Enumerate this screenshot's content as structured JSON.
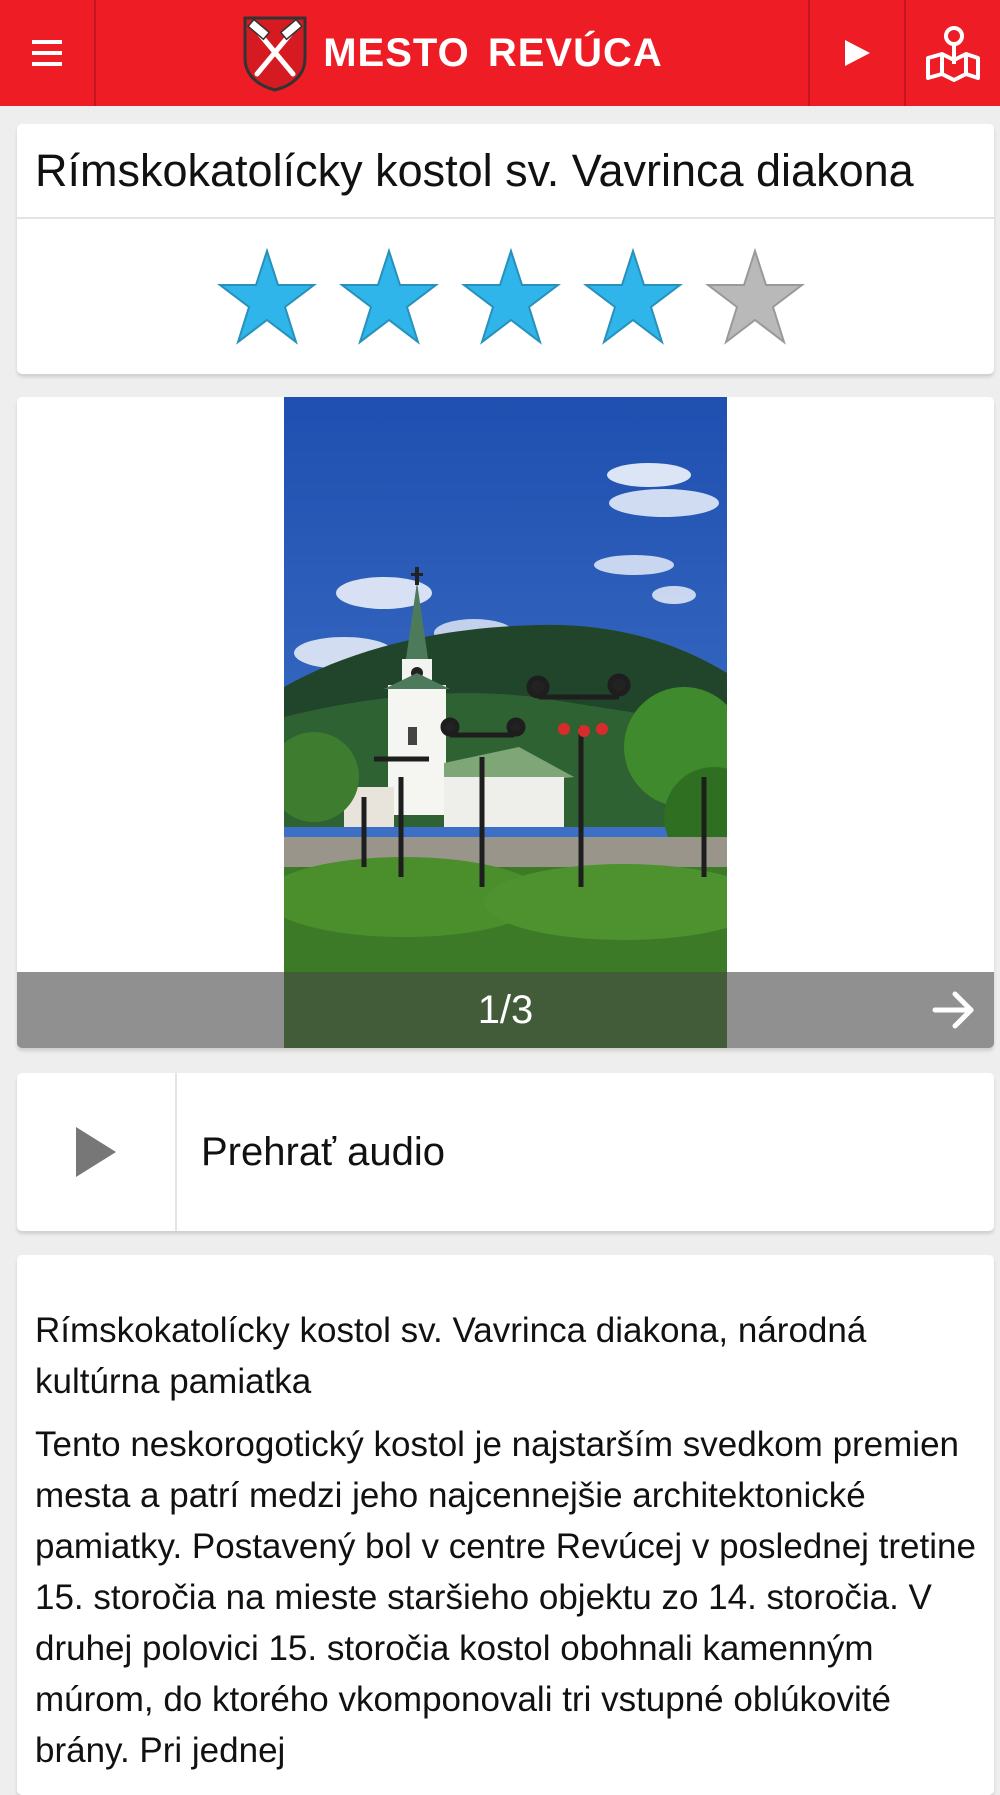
{
  "header": {
    "menu_icon": "hamburger-menu-icon",
    "logo_icon": "coat-of-arms-crossed-hammers-icon",
    "title": "MESTO REVÚCA",
    "play_icon": "play-icon",
    "map_icon": "map-pin-icon",
    "brand_color": "#ee1c25"
  },
  "place": {
    "title": "Rímskokatolícky kostol sv. Vavrinca diakona",
    "rating": 4,
    "rating_max": 5,
    "star_active_color": "#2fb5e9",
    "star_inactive_color": "#b9b9b9"
  },
  "gallery": {
    "counter": "1/3",
    "next_icon": "arrow-right-icon"
  },
  "audio": {
    "icon": "play-icon",
    "label": "Prehrať audio"
  },
  "description": {
    "subtitle": "Rímskokatolícky kostol sv. Vavrinca diakona, národná kultúrna pamiatka",
    "body": "Tento neskorogotický kostol je najstarším svedkom premien mesta a patrí medzi jeho najcennejšie architektonické pamiatky. Postavený bol v centre Revúcej v poslednej tretine 15. storočia na mieste staršieho objektu zo 14. storočia. V druhej polovici 15. storočia kostol obohnali kamenným múrom, do ktorého vkomponovali tri vstupné oblúkovité brány. Pri jednej"
  }
}
